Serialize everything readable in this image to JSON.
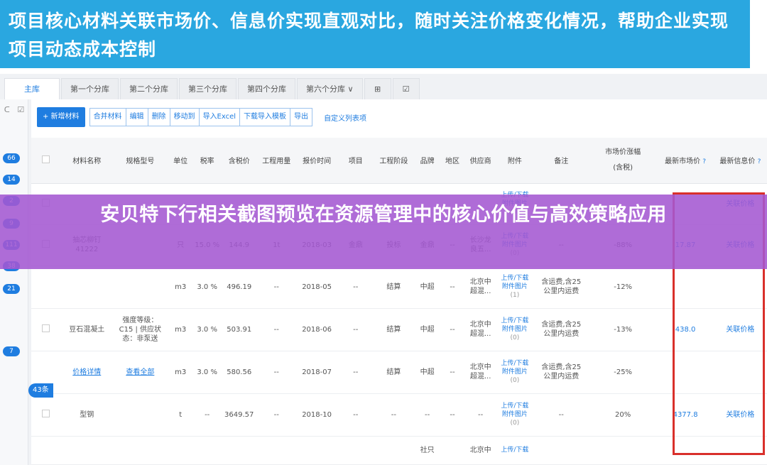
{
  "banner": {
    "text": "项目核心材料关联市场价、信息价实现直观对比，随时关注价格变化情况，帮助企业实现项目动态成本控制"
  },
  "tabs": [
    {
      "label": "主库",
      "active": true
    },
    {
      "label": "第一个分库"
    },
    {
      "label": "第二个分库"
    },
    {
      "label": "第三个分库"
    },
    {
      "label": "第四个分库"
    },
    {
      "label": "第六个分库 ∨"
    },
    {
      "label": "⊞"
    },
    {
      "label": "☑"
    }
  ],
  "strip": {
    "icon_a": "ᑕ",
    "icon_b": "☑",
    "counts": [
      "66",
      "14",
      "2",
      "9",
      "111",
      "38",
      "21",
      "7"
    ]
  },
  "toolbar": {
    "add_label": "+ 新增材料",
    "buttons": [
      "合并材料",
      "编辑",
      "删除",
      "移动到",
      "导入Excel",
      "下载导入模板",
      "导出"
    ],
    "custom_link": "自定义列表项"
  },
  "table": {
    "headers": [
      "",
      "材料名称",
      "规格型号",
      "单位",
      "税率",
      "含税价",
      "工程用量",
      "报价时间",
      "项目",
      "工程阶段",
      "品牌",
      "地区",
      "供应商",
      "附件",
      "备注",
      "市场价涨幅\n(含税)",
      "最新市场价",
      "最新信息价"
    ],
    "help_icon": "?",
    "rows": [
      {
        "name": "",
        "spec": "",
        "unit": "",
        "tax": "",
        "price": "",
        "qty": "",
        "time": "",
        "project": "",
        "stage": "",
        "brand": "",
        "region": "",
        "supplier": "",
        "attach1": "上传/下载",
        "attach2": "附件图片",
        "attach3": "(0)",
        "note": "",
        "change": "",
        "market": "",
        "info": "关联价格"
      },
      {
        "name": "抽芯柳钉\n41222",
        "spec": "",
        "unit": "只",
        "tax": "15.0 %",
        "price": "144.9",
        "qty": "1t",
        "time": "2018-03",
        "project": "金鼎",
        "stage": "投标",
        "brand": "金鼎",
        "region": "--",
        "supplier": "长沙龙\n良五...",
        "attach1": "上传/下载",
        "attach2": "附件图片",
        "attach3": "(0)",
        "note": "--",
        "change": "-88%",
        "market": "17.87",
        "info": "关联价格"
      },
      {
        "name": "",
        "spec": "",
        "unit": "m3",
        "tax": "3.0 %",
        "price": "496.19",
        "qty": "--",
        "time": "2018-05",
        "project": "--",
        "stage": "结算",
        "brand": "中超",
        "region": "--",
        "supplier": "北京中\n超混...",
        "attach1": "上传/下载",
        "attach2": "附件图片",
        "attach3": "(1)",
        "note": "含运费,含25\n公里内运费",
        "change": "-12%",
        "market": "",
        "info": ""
      },
      {
        "name": "豆石混凝土",
        "spec": "强度等级：\nC15 | 供应状\n态：非泵送",
        "unit": "m3",
        "tax": "3.0 %",
        "price": "503.91",
        "qty": "--",
        "time": "2018-06",
        "project": "--",
        "stage": "结算",
        "brand": "中超",
        "region": "--",
        "supplier": "北京中\n超混...",
        "attach1": "上传/下载",
        "attach2": "附件图片",
        "attach3": "(0)",
        "note": "含运费,含25\n公里内运费",
        "change": "-13%",
        "market": "438.0",
        "info": "关联价格"
      },
      {
        "name": "价格详情",
        "spec": "查看全部",
        "unit": "m3",
        "tax": "3.0 %",
        "price": "580.56",
        "qty": "--",
        "time": "2018-07",
        "project": "--",
        "stage": "结算",
        "brand": "中超",
        "region": "--",
        "supplier": "北京中\n超混...",
        "attach1": "上传/下载",
        "attach2": "附件图片",
        "attach3": "(0)",
        "note": "含运费,含25\n公里内运费",
        "change": "-25%",
        "market": "",
        "info": ""
      },
      {
        "name": "型钢",
        "spec": "",
        "unit": "t",
        "tax": "--",
        "price": "3649.57",
        "qty": "--",
        "time": "2018-10",
        "project": "--",
        "stage": "--",
        "brand": "--",
        "region": "--",
        "supplier": "--",
        "attach1": "上传/下载",
        "attach2": "附件图片",
        "attach3": "(0)",
        "note": "--",
        "change": "20%",
        "market": "4377.8",
        "info": "关联价格"
      },
      {
        "name": "",
        "spec": "",
        "unit": "",
        "tax": "",
        "price": "",
        "qty": "",
        "time": "",
        "project": "",
        "stage": "",
        "brand": "社只",
        "region": "",
        "supplier": "北京中",
        "attach1": "上传/下载",
        "attach2": "",
        "attach3": "",
        "note": "",
        "change": "",
        "market": "",
        "info": ""
      }
    ]
  },
  "side_count": "43条",
  "overlay": {
    "text": "安贝特下行相关截图预览在资源管理中的核心价值与高效策略应用"
  },
  "colors": {
    "banner": "#2aa7e0",
    "accent": "#1f7de0",
    "overlay": "#a458d2",
    "highlight": "#d9302b"
  }
}
